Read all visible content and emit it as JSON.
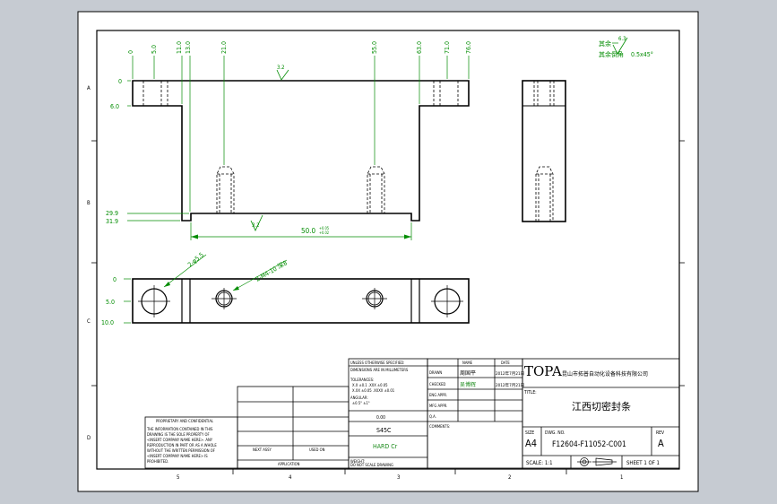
{
  "dims": {
    "top_x": [
      "0",
      "5.0",
      "11.0",
      "13.0",
      "21.0",
      "55.0",
      "63.0",
      "71.0",
      "76.0"
    ],
    "left_y_front": [
      "0",
      "6.0",
      "29.9",
      "31.9"
    ],
    "left_y_top": [
      "0",
      "5.0",
      "10.0"
    ],
    "width_dim": "50.0",
    "width_tol_upper": "+0.05",
    "width_tol_lower": "+0.02",
    "roughness_top": "3.2",
    "roughness_bottom": "3.2",
    "hole_note_1": "2-φ5.5",
    "hole_note_2": "2-M4-10 深8"
  },
  "notes": {
    "line1_prefix": "其余",
    "line1_value": "6.3",
    "line2_label": "其余倒角",
    "line2_value": "0.5x45°"
  },
  "border_zones": {
    "left_letters": [
      "A",
      "B",
      "C",
      "D"
    ],
    "bottom_numbers": [
      "5",
      "4",
      "3",
      "2",
      "1"
    ]
  },
  "title_block": {
    "unless_specified": "UNLESS OTHERWISE SPECIFIED:",
    "dimensions_are": "DIMENSIONS ARE IN MILLIMETERS",
    "tolerances": "TOLERANCES:",
    "tol_line1": "X.X ±0.1    .XXX ±0.05",
    "tol_line2": "X.XX ±0.05   .XXXX ±0.01",
    "angular": "ANGULAR:",
    "angular_line": "±0.5°   ±1°",
    "zero_rows": "0.00",
    "material_label": "MATERIAL",
    "material_value": "S45C",
    "finish_label": "FINISH",
    "finish_value": "HARD Cr",
    "drawing_label": "DRAWN",
    "checked_label": "CHECKED",
    "eng_label": "ENG APPR.",
    "mfg_label": "MFG APPR.",
    "qa_label": "Q.A.",
    "comments_label": "COMMENTS:",
    "name_header": "NAME",
    "date_header": "DATE",
    "drawn_name": "周国平",
    "drawn_date": "2012年7月21日",
    "checked_name": "吴博辉",
    "checked_date": "2012年7月21日",
    "company_logo": "TOPA",
    "company_name": "昆山市拓普自动化设备科技有限公司",
    "title_label": "TITLE:",
    "title_value": "江西切密封条",
    "size_label": "SIZE",
    "size_value": "A4",
    "dwg_no_label": "DWG. NO.",
    "dwg_no_value": "F12604-F11052-C001",
    "rev_label": "REV",
    "rev_value": "A",
    "scale_label": "SCALE: 1:1",
    "sheet_label": "SHEET 1 OF 1",
    "weight_label": "WEIGHT:",
    "next_assy": "NEXT ASSY",
    "used_on": "USED ON",
    "application": "APPLICATION",
    "do_not_scale": "DO NOT SCALE DRAWING",
    "proprietary_title": "PROPRIETARY AND CONFIDENTIAL",
    "proprietary_l1": "THE INFORMATION CONTAINED IN THIS",
    "proprietary_l2": "DRAWING IS THE SOLE PROPERTY OF",
    "proprietary_l3": "<INSERT COMPANY NAME HERE>. ANY",
    "proprietary_l4": "REPRODUCTION IN PART OR AS A WHOLE",
    "proprietary_l5": "WITHOUT THE WRITTEN PERMISSION OF",
    "proprietary_l6": "<INSERT COMPANY NAME HERE> IS",
    "proprietary_l7": "PROHIBITED."
  },
  "colors": {
    "background": "#c6cbd2",
    "paper": "#ffffff",
    "line": "#000000",
    "dimension": "#008c00",
    "signature": "#1a8a1a"
  }
}
